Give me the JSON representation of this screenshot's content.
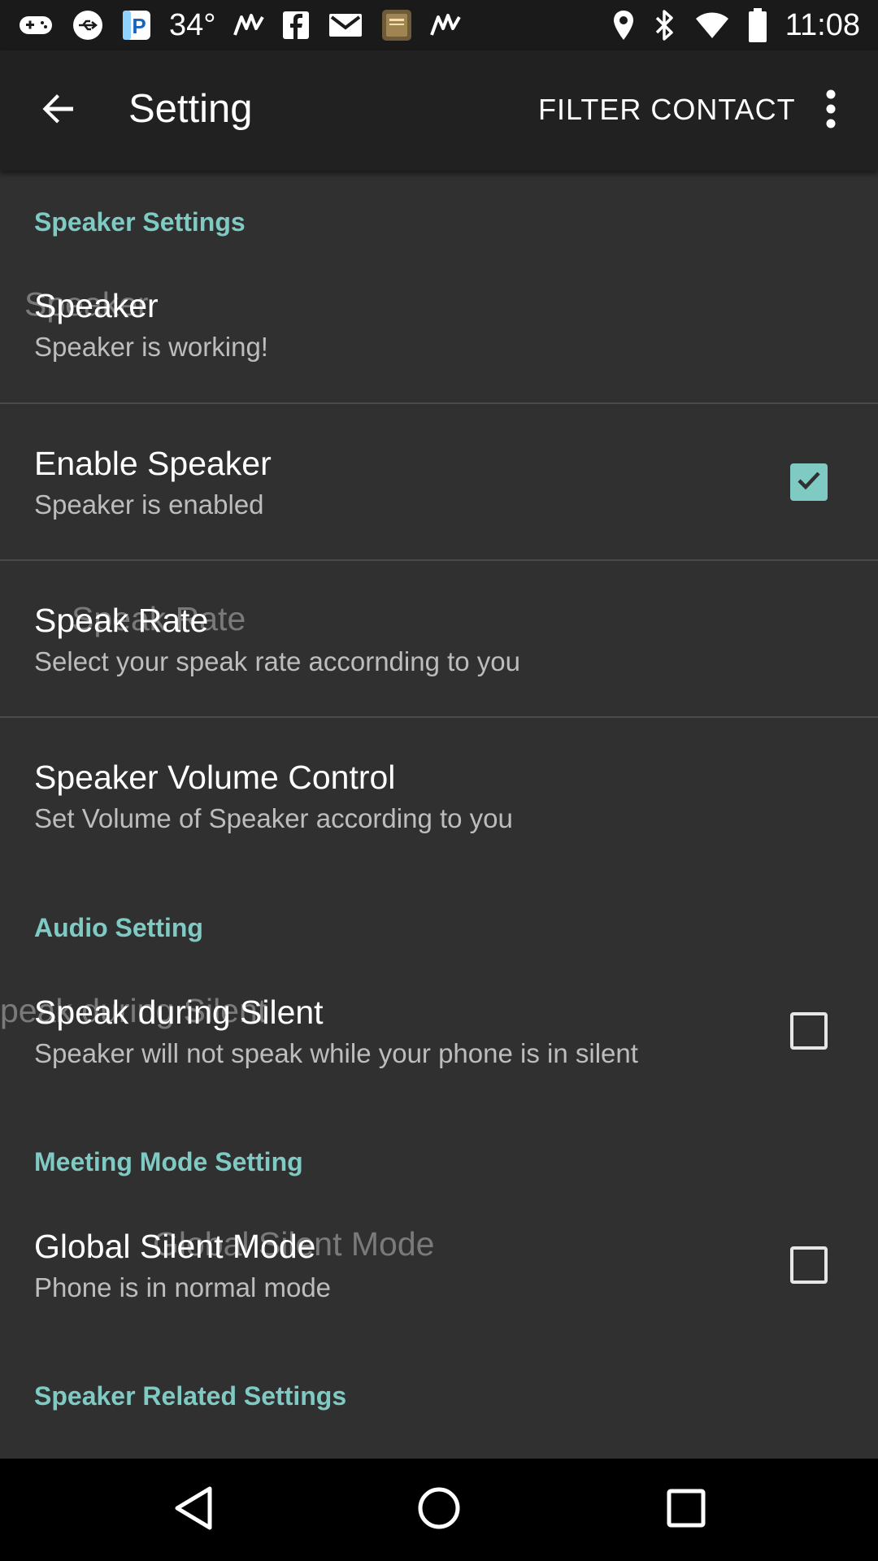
{
  "status_bar": {
    "temperature": "34°",
    "time": "11:08",
    "left_icons": [
      "gamepad-icon",
      "usb-icon",
      "parking-app-icon",
      "temperature-text",
      "mountain-wave-icon",
      "facebook-icon",
      "gmail-icon",
      "bible-app-icon",
      "mountain-wave-icon"
    ],
    "right_icons": [
      "location-icon",
      "bluetooth-icon",
      "wifi-icon",
      "battery-icon"
    ]
  },
  "app_bar": {
    "title": "Setting",
    "action": "FILTER CONTACT",
    "back_icon": "back-arrow-icon",
    "overflow_icon": "more-vert-icon"
  },
  "sections": [
    {
      "category": "Speaker Settings",
      "items": [
        {
          "title": "Speaker",
          "ghost_title": "Speaker",
          "summary": "Speaker is working!",
          "control": "none"
        },
        {
          "title": "Enable Speaker",
          "summary": "Speaker is enabled",
          "control": "checkbox",
          "checked": true
        },
        {
          "title": "Speak Rate",
          "ghost_title": "Speak Rate",
          "summary": "Select your speak rate accornding to you",
          "control": "none"
        },
        {
          "title": "Speaker Volume Control",
          "summary": "Set Volume of Speaker according to you",
          "control": "none"
        }
      ]
    },
    {
      "category": "Audio Setting",
      "items": [
        {
          "title": "Speak during Silent",
          "ghost_title": "peak during Silent",
          "summary": "Speaker will not speak while your phone is in silent",
          "control": "checkbox",
          "checked": false
        }
      ]
    },
    {
      "category": "Meeting Mode Setting",
      "items": [
        {
          "title": "Global Silent Mode",
          "ghost_title": "Global Silent Mode",
          "summary": "Phone is in normal mode",
          "control": "checkbox",
          "checked": false
        }
      ]
    },
    {
      "category": "Speaker Related Settings",
      "items": []
    }
  ],
  "nav_bar": {
    "back": "nav-back-icon",
    "home": "nav-home-icon",
    "recents": "nav-recents-icon"
  },
  "colors": {
    "accent": "#7fcbc4",
    "background": "#303030",
    "app_bar": "#212121",
    "status_bar": "#1a1a1a"
  }
}
